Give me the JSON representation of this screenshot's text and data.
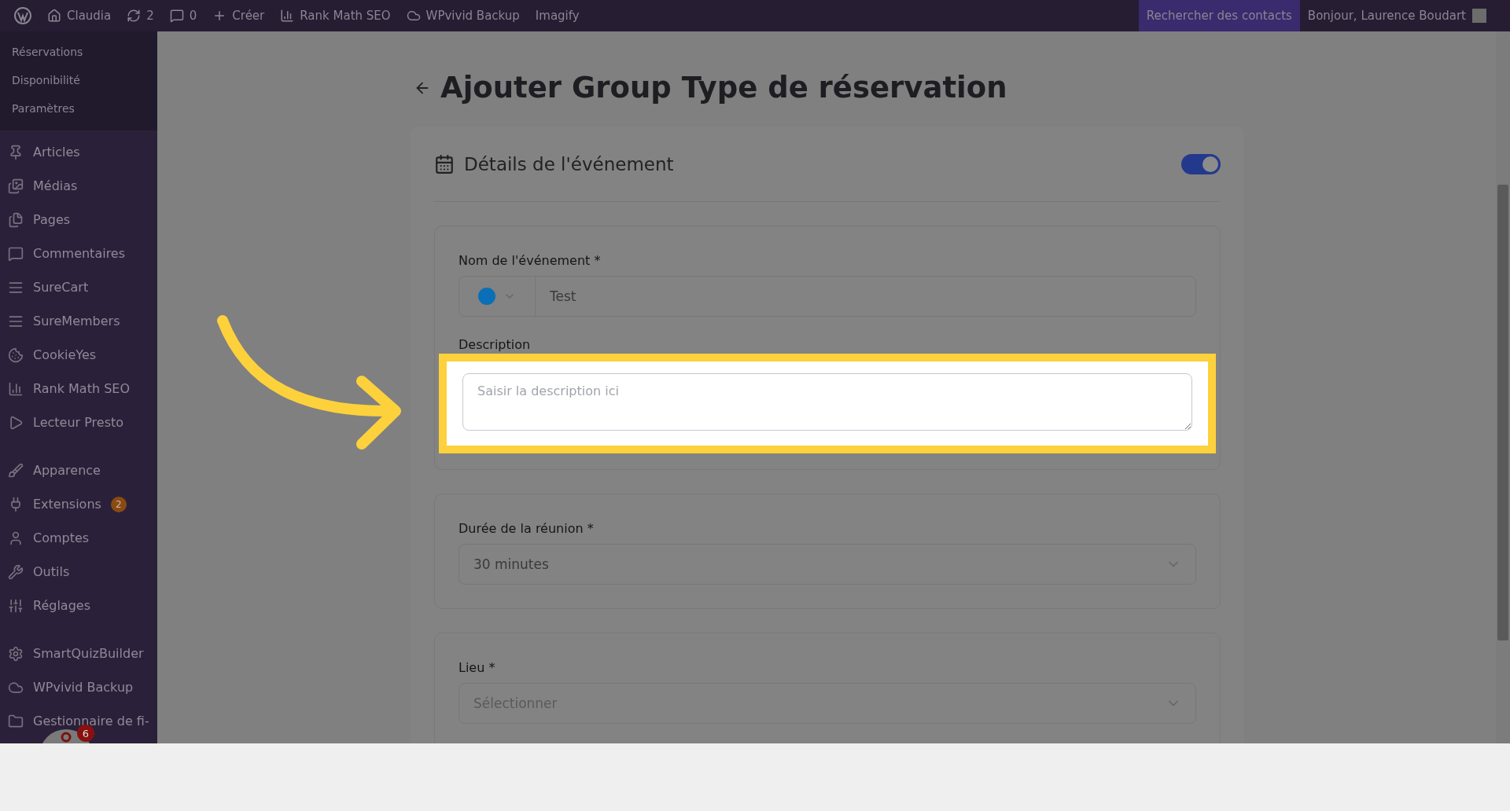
{
  "admin_bar": {
    "items": [
      {
        "kind": "logo"
      },
      {
        "kind": "home",
        "label": "Claudia"
      },
      {
        "kind": "updates",
        "label": "2"
      },
      {
        "kind": "comments",
        "label": "0"
      },
      {
        "kind": "new",
        "label": "Créer"
      },
      {
        "kind": "chart",
        "label": "Rank Math SEO"
      },
      {
        "kind": "cloud",
        "label": "WPvivid Backup"
      },
      {
        "kind": "text",
        "label": "Imagify"
      }
    ],
    "search_contacts": "Rechercher des contacts",
    "greeting": "Bonjour, Laurence Boudart"
  },
  "sidebar": {
    "submenu": [
      "Réservations",
      "Disponibilité",
      "Paramètres"
    ],
    "groups": [
      [
        {
          "label": "Articles"
        },
        {
          "label": "Médias"
        },
        {
          "label": "Pages"
        },
        {
          "label": "Commentaires"
        },
        {
          "label": "SureCart"
        },
        {
          "label": "SureMembers"
        },
        {
          "label": "CookieYes"
        },
        {
          "label": "Rank Math SEO"
        },
        {
          "label": "Lecteur Presto"
        }
      ],
      [
        {
          "label": "Apparence"
        },
        {
          "label": "Extensions",
          "badge": "2"
        },
        {
          "label": "Comptes"
        },
        {
          "label": "Outils"
        },
        {
          "label": "Réglages"
        }
      ],
      [
        {
          "label": "SmartQuizBuilder"
        },
        {
          "label": "WPvivid Backup"
        },
        {
          "label": "Gestionnaire de fi-"
        }
      ]
    ],
    "bubble_badge": "6"
  },
  "page": {
    "title": "Ajouter Group Type de réservation",
    "section": {
      "title": "Détails de l'événement",
      "enabled": true,
      "fields": [
        {
          "kind": "name",
          "label": "Nom de l'événement *",
          "color": "#0a6fb7",
          "value": "Test"
        },
        {
          "kind": "textarea",
          "label": "Description",
          "placeholder": "Saisir la description ici"
        },
        {
          "kind": "select",
          "label": "Durée de la réunion *",
          "value": "30 minutes"
        },
        {
          "kind": "select",
          "label": "Lieu *",
          "placeholder": "Sélectionner"
        }
      ]
    }
  }
}
